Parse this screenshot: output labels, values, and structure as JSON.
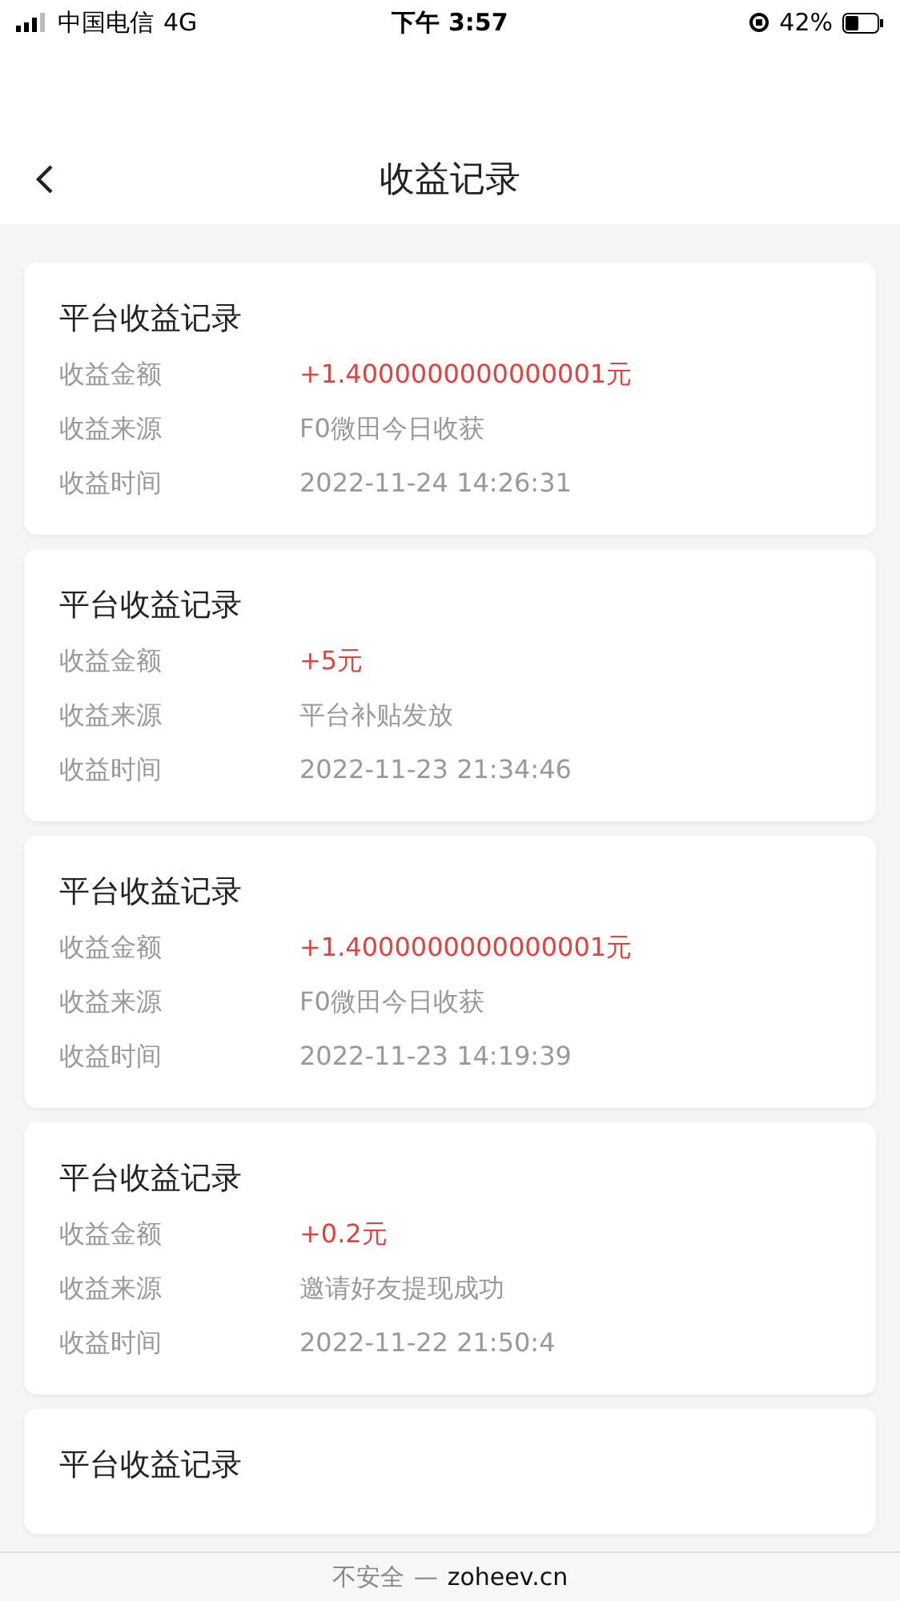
{
  "status_bar": {
    "carrier": "中国电信",
    "network": "4G",
    "time": "下午 3:57",
    "battery": "42%"
  },
  "header": {
    "title": "收益记录"
  },
  "records": [
    {
      "title": "平台收益记录",
      "rows": [
        {
          "label": "收益金额",
          "value": "+1.4000000000000001元",
          "kind": "amount"
        },
        {
          "label": "收益来源",
          "value": "F0微田今日收获",
          "kind": "text"
        },
        {
          "label": "收益时间",
          "value": "2022-11-24 14:26:31",
          "kind": "text"
        }
      ]
    },
    {
      "title": "平台收益记录",
      "rows": [
        {
          "label": "收益金额",
          "value": "+5元",
          "kind": "amount"
        },
        {
          "label": "收益来源",
          "value": "平台补贴发放",
          "kind": "text"
        },
        {
          "label": "收益时间",
          "value": "2022-11-23 21:34:46",
          "kind": "text"
        }
      ]
    },
    {
      "title": "平台收益记录",
      "rows": [
        {
          "label": "收益金额",
          "value": "+1.4000000000000001元",
          "kind": "amount"
        },
        {
          "label": "收益来源",
          "value": "F0微田今日收获",
          "kind": "text"
        },
        {
          "label": "收益时间",
          "value": "2022-11-23 14:19:39",
          "kind": "text"
        }
      ]
    },
    {
      "title": "平台收益记录",
      "rows": [
        {
          "label": "收益金额",
          "value": "+0.2元",
          "kind": "amount"
        },
        {
          "label": "收益来源",
          "value": "邀请好友提现成功",
          "kind": "text"
        },
        {
          "label": "收益时间",
          "value": "2022-11-22 21:50:4",
          "kind": "text"
        }
      ]
    },
    {
      "title": "平台收益记录"
    }
  ],
  "address_bar": {
    "security": "不安全",
    "separator": "—",
    "domain": "zoheev.cn"
  }
}
